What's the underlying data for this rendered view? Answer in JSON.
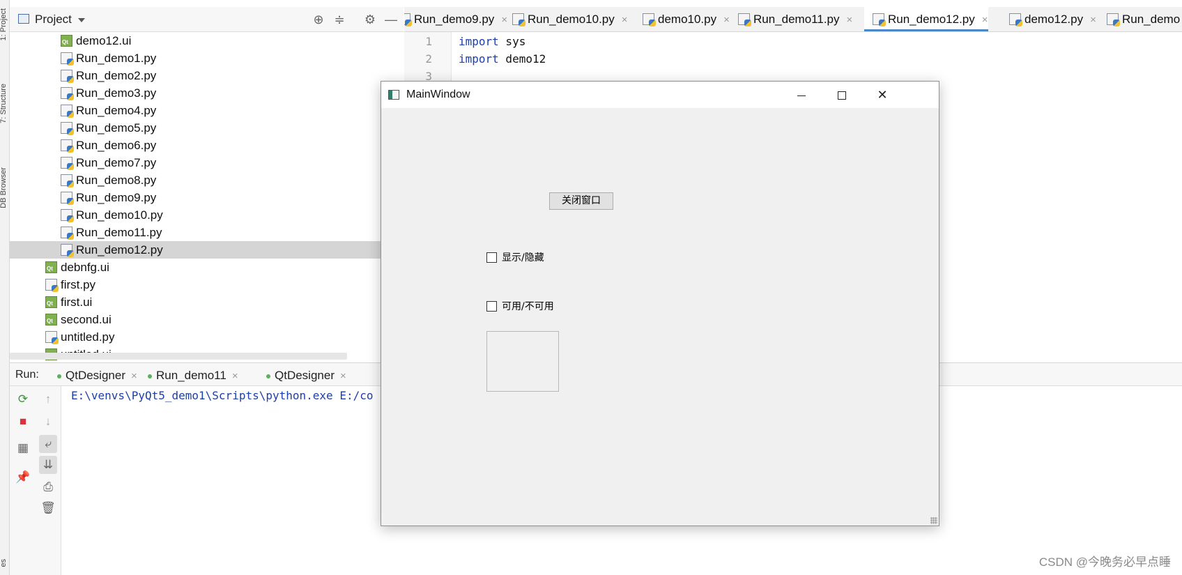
{
  "ide": {
    "left_strip": {
      "project_tab": "1: Project",
      "structure_tab": "7: Structure",
      "db_tab": "DB Browser",
      "bottom_tab": "es"
    },
    "project_panel": {
      "title": "Project",
      "icons": [
        "target-icon",
        "collapse-icon",
        "gear-icon",
        "minimize-icon"
      ],
      "files": [
        {
          "name": "demo12.ui",
          "type": "ui",
          "indent": 2
        },
        {
          "name": "Run_demo1.py",
          "type": "py",
          "indent": 2
        },
        {
          "name": "Run_demo2.py",
          "type": "py",
          "indent": 2
        },
        {
          "name": "Run_demo3.py",
          "type": "py",
          "indent": 2
        },
        {
          "name": "Run_demo4.py",
          "type": "py",
          "indent": 2
        },
        {
          "name": "Run_demo5.py",
          "type": "py",
          "indent": 2
        },
        {
          "name": "Run_demo6.py",
          "type": "py",
          "indent": 2
        },
        {
          "name": "Run_demo7.py",
          "type": "py",
          "indent": 2
        },
        {
          "name": "Run_demo8.py",
          "type": "py",
          "indent": 2
        },
        {
          "name": "Run_demo9.py",
          "type": "py",
          "indent": 2
        },
        {
          "name": "Run_demo10.py",
          "type": "py",
          "indent": 2
        },
        {
          "name": "Run_demo11.py",
          "type": "py",
          "indent": 2
        },
        {
          "name": "Run_demo12.py",
          "type": "py",
          "indent": 2,
          "selected": true
        },
        {
          "name": "debnfg.ui",
          "type": "ui",
          "indent": 1
        },
        {
          "name": "first.py",
          "type": "py",
          "indent": 1
        },
        {
          "name": "first.ui",
          "type": "ui",
          "indent": 1
        },
        {
          "name": "second.ui",
          "type": "ui",
          "indent": 1
        },
        {
          "name": "untitled.py",
          "type": "py",
          "indent": 1
        },
        {
          "name": "untitled.ui",
          "type": "ui",
          "indent": 1
        }
      ]
    },
    "editor_tabs": [
      {
        "name": "Run_demo9.py",
        "close": "×"
      },
      {
        "name": "Run_demo10.py",
        "close": "×"
      },
      {
        "name": "demo10.py",
        "close": "×"
      },
      {
        "name": "Run_demo11.py",
        "close": "×"
      },
      {
        "name": "Run_demo12.py",
        "close": "×",
        "active": true
      },
      {
        "name": "demo12.py",
        "close": "×"
      },
      {
        "name": "Run_demo",
        "close": ""
      }
    ],
    "editor": {
      "lines": [
        {
          "num": "1",
          "kw": "import",
          "rest": " sys"
        },
        {
          "num": "2",
          "kw": "import",
          "rest": " demo12"
        },
        {
          "num": "3",
          "kw": "",
          "rest": ""
        }
      ]
    },
    "run_panel": {
      "label": "Run:",
      "tabs": [
        {
          "name": "QtDesigner",
          "close": "×"
        },
        {
          "name": "Run_demo11",
          "close": "×"
        },
        {
          "name": "QtDesigner",
          "close": "×"
        }
      ],
      "console_line": "E:\\venvs\\PyQt5_demo1\\Scripts\\python.exe E:/co"
    },
    "watermark": "CSDN @今晚务必早点睡"
  },
  "main_window": {
    "title": "MainWindow",
    "minimize": "",
    "maximize": "",
    "close": "✕",
    "close_button_label": "关闭窗口",
    "checkbox_show_hide": "显示/隐藏",
    "checkbox_enable_disable": "可用/不可用"
  }
}
